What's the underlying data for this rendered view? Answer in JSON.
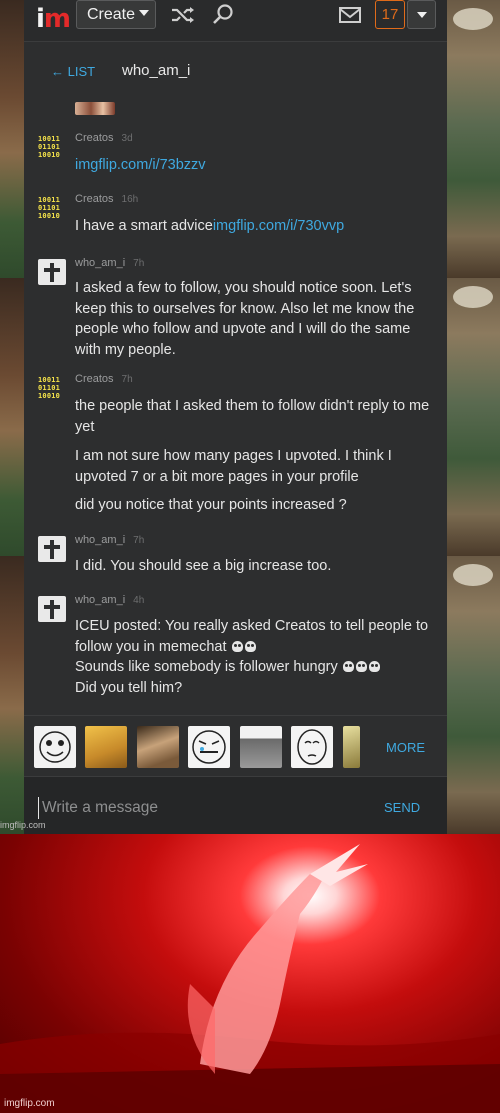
{
  "topbar": {
    "create_label": "Create",
    "notification_count": "17"
  },
  "chat": {
    "back_label": "← LIST",
    "username": "who_am_i"
  },
  "messages": [
    {
      "user": "Creatos",
      "time": "3d",
      "link": "imgflip.com/i/73bzzv"
    },
    {
      "user": "Creatos",
      "time": "16h",
      "text": "I have a smart advice",
      "link": "imgflip.com/i/730vvp"
    },
    {
      "user": "who_am_i",
      "time": "7h",
      "text": "I asked a few to follow, you should notice soon. Let's keep this to ourselves for know. Also let me know the people who follow and upvote and I will do the same with my people."
    },
    {
      "user": "Creatos",
      "time": "7h",
      "lines": [
        "the people that I asked them to follow didn't reply to me yet",
        "I am not sure how many pages I upvoted. I think I upvoted 7 or a bit more pages in your profile",
        "did you notice that your points increased ?"
      ]
    },
    {
      "user": "who_am_i",
      "time": "7h",
      "text": "I did. You should see a big increase too."
    },
    {
      "user": "who_am_i",
      "time": "4h",
      "line1": "ICEU posted: You really asked Creatos to tell people to follow you in memechat",
      "line2": "Sounds like somebody is follower hungry",
      "line3": "Did you tell him?"
    }
  ],
  "picker": {
    "more_label": "MORE"
  },
  "composer": {
    "placeholder": "Write a message",
    "send_label": "SEND"
  },
  "watermarks": {
    "top": "imgflip.com",
    "bottom": "imgflip.com"
  },
  "colors": {
    "accent": "#3fa9e0",
    "notification": "#e06b1a",
    "panel": "#2d2e2f"
  }
}
